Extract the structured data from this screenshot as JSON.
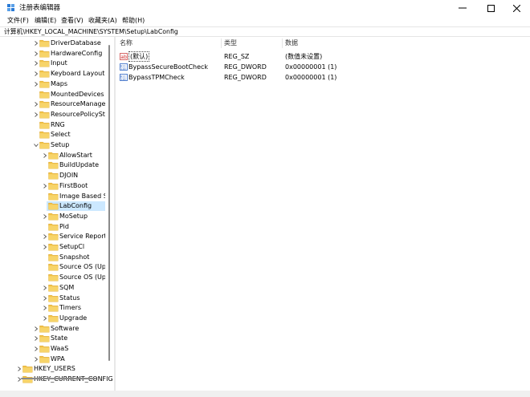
{
  "window": {
    "title": "注册表编辑器"
  },
  "menu": [
    "文件(F)",
    "编辑(E)",
    "查看(V)",
    "收藏夹(A)",
    "帮助(H)"
  ],
  "address": "计算机\\HKEY_LOCAL_MACHINE\\SYSTEM\\Setup\\LabConfig",
  "tree": [
    {
      "label": "DriverDatabase",
      "level": 3,
      "expandable": true
    },
    {
      "label": "HardwareConfig",
      "level": 3,
      "expandable": true
    },
    {
      "label": "Input",
      "level": 3,
      "expandable": true
    },
    {
      "label": "Keyboard Layout",
      "level": 3,
      "expandable": true
    },
    {
      "label": "Maps",
      "level": 3,
      "expandable": true
    },
    {
      "label": "MountedDevices",
      "level": 3,
      "expandable": false
    },
    {
      "label": "ResourceManager",
      "level": 3,
      "expandable": true
    },
    {
      "label": "ResourcePolicySto",
      "level": 3,
      "expandable": true
    },
    {
      "label": "RNG",
      "level": 3,
      "expandable": false
    },
    {
      "label": "Select",
      "level": 3,
      "expandable": false
    },
    {
      "label": "Setup",
      "level": 3,
      "expandable": true,
      "expanded": true
    },
    {
      "label": "AllowStart",
      "level": 4,
      "expandable": true
    },
    {
      "label": "BuildUpdate",
      "level": 4,
      "expandable": false
    },
    {
      "label": "DJOIN",
      "level": 4,
      "expandable": false
    },
    {
      "label": "FirstBoot",
      "level": 4,
      "expandable": true
    },
    {
      "label": "Image Based Se",
      "level": 4,
      "expandable": false
    },
    {
      "label": "LabConfig",
      "level": 4,
      "expandable": false,
      "selected": true
    },
    {
      "label": "MoSetup",
      "level": 4,
      "expandable": true
    },
    {
      "label": "Pid",
      "level": 4,
      "expandable": false
    },
    {
      "label": "Service Reportir",
      "level": 4,
      "expandable": true
    },
    {
      "label": "SetupCl",
      "level": 4,
      "expandable": true
    },
    {
      "label": "Snapshot",
      "level": 4,
      "expandable": false
    },
    {
      "label": "Source OS (Upc",
      "level": 4,
      "expandable": false
    },
    {
      "label": "Source OS (Upc",
      "level": 4,
      "expandable": false
    },
    {
      "label": "SQM",
      "level": 4,
      "expandable": true
    },
    {
      "label": "Status",
      "level": 4,
      "expandable": true
    },
    {
      "label": "Timers",
      "level": 4,
      "expandable": true
    },
    {
      "label": "Upgrade",
      "level": 4,
      "expandable": true
    },
    {
      "label": "Software",
      "level": 3,
      "expandable": true
    },
    {
      "label": "State",
      "level": 3,
      "expandable": true
    },
    {
      "label": "WaaS",
      "level": 3,
      "expandable": true
    },
    {
      "label": "WPA",
      "level": 3,
      "expandable": true
    },
    {
      "label": "HKEY_USERS",
      "level": 1,
      "expandable": true
    },
    {
      "label": "HKEY_CURRENT_CONFIG",
      "level": 1,
      "expandable": true
    }
  ],
  "columns": {
    "name": "名称",
    "type": "类型",
    "data": "数据"
  },
  "values": [
    {
      "name": "(默认)",
      "type": "REG_SZ",
      "data": "(数值未设置)",
      "icon": "string-value-icon"
    },
    {
      "name": "BypassSecureBootCheck",
      "type": "REG_DWORD",
      "data": "0x00000001 (1)",
      "icon": "binary-value-icon"
    },
    {
      "name": "BypassTPMCheck",
      "type": "REG_DWORD",
      "data": "0x00000001 (1)",
      "icon": "binary-value-icon"
    }
  ],
  "colors": {
    "selection": "#cce8ff",
    "folder": "#f3c348",
    "accent": "#0067c0"
  }
}
